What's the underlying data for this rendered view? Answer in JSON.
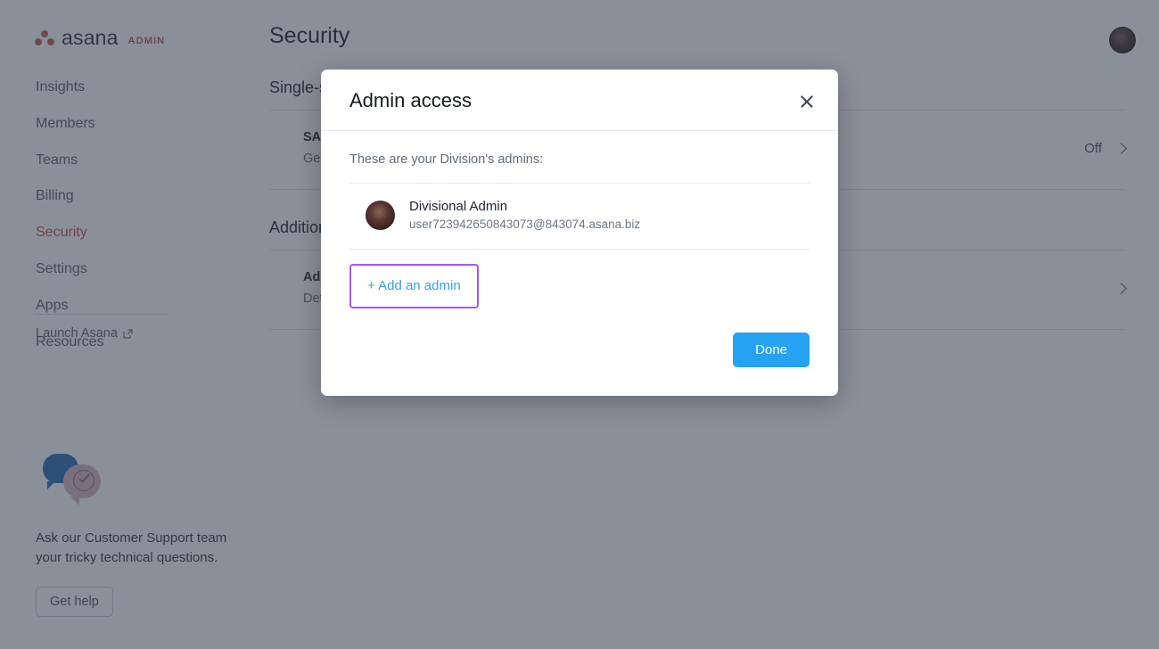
{
  "brand": {
    "name": "asana",
    "suffix": "ADMIN",
    "logo_icon": "asana-dots-logo",
    "dot_color": "#cd5a52",
    "admin_color": "#c3554e"
  },
  "sidebar": {
    "items": [
      {
        "label": "Insights",
        "active": false
      },
      {
        "label": "Members",
        "active": false
      },
      {
        "label": "Teams",
        "active": false
      },
      {
        "label": "Billing",
        "active": false
      },
      {
        "label": "Security",
        "active": true
      },
      {
        "label": "Settings",
        "active": false
      },
      {
        "label": "Apps",
        "active": false
      },
      {
        "label": "Resources",
        "active": false
      }
    ],
    "active_color": "#cc4b42",
    "launch": {
      "label": "Launch Asana",
      "icon": "external-link-icon"
    },
    "support": {
      "icon": "chat-bubbles-check-icon",
      "text": "Ask our Customer Support team your tricky technical questions.",
      "button_label": "Get help"
    }
  },
  "header": {
    "title": "Security",
    "avatar_icon": "user-avatar"
  },
  "main": {
    "sections": [
      {
        "heading": "Single-sign on",
        "rows": [
          {
            "title": "SAML authentication",
            "subtitle": "Get secure and easy access to Asana with single sign-on",
            "value": "Off",
            "chevron": "chevron-right-icon"
          }
        ]
      },
      {
        "heading": "Additional settings",
        "rows": [
          {
            "title": "Admin access",
            "subtitle": "Determine who has administrative privileges",
            "value": "",
            "chevron": "chevron-right-icon"
          }
        ]
      }
    ]
  },
  "modal": {
    "title": "Admin access",
    "close_icon": "close-icon",
    "note": "These are your Division's admins:",
    "admins": [
      {
        "name": "Divisional Admin",
        "email": "user723942650843073@843074.asana.biz",
        "avatar_icon": "user-avatar"
      }
    ],
    "add_admin_label": "+ Add an admin",
    "add_admin_highlight_color": "#a855f7",
    "done_label": "Done",
    "done_color": "#25a2f2",
    "link_color": "#33a3f0"
  }
}
